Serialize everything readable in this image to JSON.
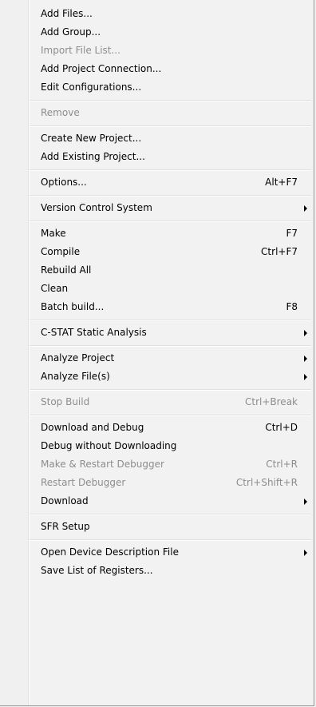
{
  "menu": {
    "add_files": "Add Files...",
    "add_group": "Add Group...",
    "import_file_list": "Import File List...",
    "add_project_connection": "Add Project Connection...",
    "edit_configurations": "Edit Configurations...",
    "remove": "Remove",
    "create_new_project": "Create New Project...",
    "add_existing_project": "Add Existing Project...",
    "options": "Options...",
    "options_shortcut": "Alt+F7",
    "version_control_system": "Version Control System",
    "make": "Make",
    "make_shortcut": "F7",
    "compile": "Compile",
    "compile_shortcut": "Ctrl+F7",
    "rebuild_all": "Rebuild All",
    "clean": "Clean",
    "batch_build": "Batch build...",
    "batch_build_shortcut": "F8",
    "cstat": "C-STAT Static Analysis",
    "analyze_project": "Analyze Project",
    "analyze_files": "Analyze File(s)",
    "stop_build": "Stop Build",
    "stop_build_shortcut": "Ctrl+Break",
    "download_and_debug": "Download and Debug",
    "download_and_debug_shortcut": "Ctrl+D",
    "debug_without_downloading": "Debug without Downloading",
    "make_restart_debugger": "Make & Restart Debugger",
    "make_restart_debugger_shortcut": "Ctrl+R",
    "restart_debugger": "Restart Debugger",
    "restart_debugger_shortcut": "Ctrl+Shift+R",
    "download": "Download",
    "sfr_setup": "SFR Setup",
    "open_device_description_file": "Open Device Description File",
    "save_list_of_registers": "Save List of Registers..."
  }
}
